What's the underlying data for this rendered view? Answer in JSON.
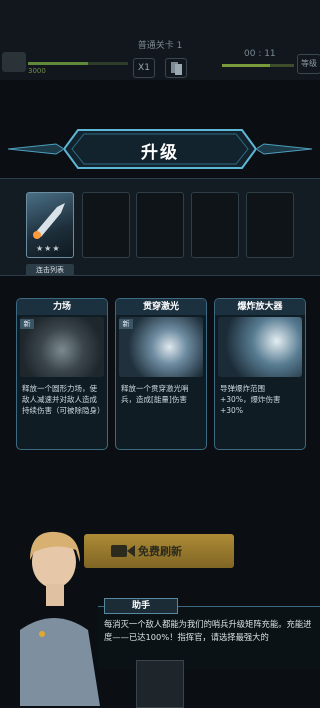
{
  "hud": {
    "level_title": "普通关卡 1",
    "score": "3000",
    "speed_label": "X1",
    "timer": "00 : 11",
    "right_label": "等级"
  },
  "banner": {
    "title": "升级"
  },
  "combo": {
    "label": "连击列表",
    "stars": "★★★"
  },
  "cards": [
    {
      "name": "力场",
      "badge": "新",
      "desc": "释放一个圆形力场，使敌人减速并对敌人造成持续伤害（可被除隐身）"
    },
    {
      "name": "贯穿激光",
      "badge": "新",
      "desc": "释放一个贯穿激光哨兵，造成[能量]伤害"
    },
    {
      "name": "爆炸放大器",
      "badge": "",
      "desc": "导弹爆炸范围\n+30%，爆炸伤害\n+30%"
    }
  ],
  "refresh": {
    "label": "免费刷新"
  },
  "assistant": {
    "tag": "助手",
    "message": "每消灭一个敌人都能为我们的哨兵升级矩阵充能。充能进度——已达100%！指挥官，请选择最强大的"
  },
  "colors": {
    "accent": "#3b6a82",
    "gold": "#ad8b36"
  }
}
